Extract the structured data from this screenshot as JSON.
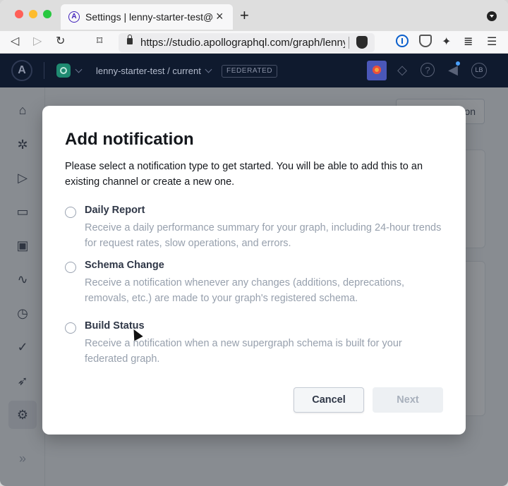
{
  "browser": {
    "tab_title": "Settings | lenny-starter-test@current",
    "tab_close": "×",
    "new_tab": "+",
    "url": "https://studio.apollographql.com/graph/lenny-starter-test/settings",
    "back": "◁",
    "forward": "▷",
    "reload": "↻",
    "bookmark": "⌑"
  },
  "app_header": {
    "logo": "A",
    "graph_name": "lenny-starter-test / current",
    "badge": "FEDERATED",
    "help": "?",
    "user_initials": "LB"
  },
  "background": {
    "button_label": "on"
  },
  "modal": {
    "title": "Add notification",
    "description": "Please select a notification type to get started. You will be able to add this to an existing channel or create a new one.",
    "options": [
      {
        "label": "Daily Report",
        "description": "Receive a daily performance summary for your graph, including 24-hour trends for request rates, slow operations, and errors.",
        "selected": false
      },
      {
        "label": "Schema Change",
        "description": "Receive a notification whenever any changes (additions, deprecations, removals, etc.) are made to your graph's registered schema.",
        "selected": false
      },
      {
        "label": "Build Status",
        "description": "Receive a notification when a new supergraph schema is built for your federated graph.",
        "selected": false
      }
    ],
    "cancel_label": "Cancel",
    "next_label": "Next"
  },
  "icons": {
    "sidebar": [
      "home-icon",
      "graph-icon",
      "explorer-icon",
      "schema-icon",
      "clients-icon",
      "operations-icon",
      "history-icon",
      "checks-icon",
      "launches-icon",
      "settings-icon"
    ],
    "collapse": "»"
  },
  "colors": {
    "app_header_bg": "#0f1a2e",
    "modal_bg": "#ffffff",
    "accent": "#3f20ba"
  }
}
